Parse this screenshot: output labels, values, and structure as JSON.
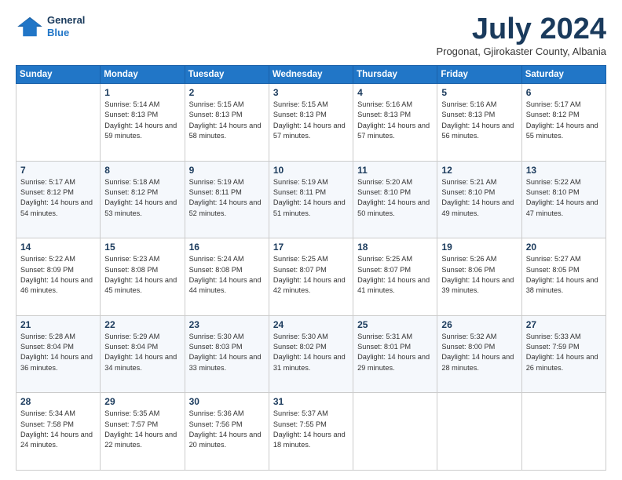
{
  "logo": {
    "line1": "General",
    "line2": "Blue"
  },
  "title": "July 2024",
  "location": "Progonat, Gjirokaster County, Albania",
  "days_header": [
    "Sunday",
    "Monday",
    "Tuesday",
    "Wednesday",
    "Thursday",
    "Friday",
    "Saturday"
  ],
  "weeks": [
    [
      {
        "day": "",
        "sunrise": "",
        "sunset": "",
        "daylight": ""
      },
      {
        "day": "1",
        "sunrise": "Sunrise: 5:14 AM",
        "sunset": "Sunset: 8:13 PM",
        "daylight": "Daylight: 14 hours and 59 minutes."
      },
      {
        "day": "2",
        "sunrise": "Sunrise: 5:15 AM",
        "sunset": "Sunset: 8:13 PM",
        "daylight": "Daylight: 14 hours and 58 minutes."
      },
      {
        "day": "3",
        "sunrise": "Sunrise: 5:15 AM",
        "sunset": "Sunset: 8:13 PM",
        "daylight": "Daylight: 14 hours and 57 minutes."
      },
      {
        "day": "4",
        "sunrise": "Sunrise: 5:16 AM",
        "sunset": "Sunset: 8:13 PM",
        "daylight": "Daylight: 14 hours and 57 minutes."
      },
      {
        "day": "5",
        "sunrise": "Sunrise: 5:16 AM",
        "sunset": "Sunset: 8:13 PM",
        "daylight": "Daylight: 14 hours and 56 minutes."
      },
      {
        "day": "6",
        "sunrise": "Sunrise: 5:17 AM",
        "sunset": "Sunset: 8:12 PM",
        "daylight": "Daylight: 14 hours and 55 minutes."
      }
    ],
    [
      {
        "day": "7",
        "sunrise": "Sunrise: 5:17 AM",
        "sunset": "Sunset: 8:12 PM",
        "daylight": "Daylight: 14 hours and 54 minutes."
      },
      {
        "day": "8",
        "sunrise": "Sunrise: 5:18 AM",
        "sunset": "Sunset: 8:12 PM",
        "daylight": "Daylight: 14 hours and 53 minutes."
      },
      {
        "day": "9",
        "sunrise": "Sunrise: 5:19 AM",
        "sunset": "Sunset: 8:11 PM",
        "daylight": "Daylight: 14 hours and 52 minutes."
      },
      {
        "day": "10",
        "sunrise": "Sunrise: 5:19 AM",
        "sunset": "Sunset: 8:11 PM",
        "daylight": "Daylight: 14 hours and 51 minutes."
      },
      {
        "day": "11",
        "sunrise": "Sunrise: 5:20 AM",
        "sunset": "Sunset: 8:10 PM",
        "daylight": "Daylight: 14 hours and 50 minutes."
      },
      {
        "day": "12",
        "sunrise": "Sunrise: 5:21 AM",
        "sunset": "Sunset: 8:10 PM",
        "daylight": "Daylight: 14 hours and 49 minutes."
      },
      {
        "day": "13",
        "sunrise": "Sunrise: 5:22 AM",
        "sunset": "Sunset: 8:10 PM",
        "daylight": "Daylight: 14 hours and 47 minutes."
      }
    ],
    [
      {
        "day": "14",
        "sunrise": "Sunrise: 5:22 AM",
        "sunset": "Sunset: 8:09 PM",
        "daylight": "Daylight: 14 hours and 46 minutes."
      },
      {
        "day": "15",
        "sunrise": "Sunrise: 5:23 AM",
        "sunset": "Sunset: 8:08 PM",
        "daylight": "Daylight: 14 hours and 45 minutes."
      },
      {
        "day": "16",
        "sunrise": "Sunrise: 5:24 AM",
        "sunset": "Sunset: 8:08 PM",
        "daylight": "Daylight: 14 hours and 44 minutes."
      },
      {
        "day": "17",
        "sunrise": "Sunrise: 5:25 AM",
        "sunset": "Sunset: 8:07 PM",
        "daylight": "Daylight: 14 hours and 42 minutes."
      },
      {
        "day": "18",
        "sunrise": "Sunrise: 5:25 AM",
        "sunset": "Sunset: 8:07 PM",
        "daylight": "Daylight: 14 hours and 41 minutes."
      },
      {
        "day": "19",
        "sunrise": "Sunrise: 5:26 AM",
        "sunset": "Sunset: 8:06 PM",
        "daylight": "Daylight: 14 hours and 39 minutes."
      },
      {
        "day": "20",
        "sunrise": "Sunrise: 5:27 AM",
        "sunset": "Sunset: 8:05 PM",
        "daylight": "Daylight: 14 hours and 38 minutes."
      }
    ],
    [
      {
        "day": "21",
        "sunrise": "Sunrise: 5:28 AM",
        "sunset": "Sunset: 8:04 PM",
        "daylight": "Daylight: 14 hours and 36 minutes."
      },
      {
        "day": "22",
        "sunrise": "Sunrise: 5:29 AM",
        "sunset": "Sunset: 8:04 PM",
        "daylight": "Daylight: 14 hours and 34 minutes."
      },
      {
        "day": "23",
        "sunrise": "Sunrise: 5:30 AM",
        "sunset": "Sunset: 8:03 PM",
        "daylight": "Daylight: 14 hours and 33 minutes."
      },
      {
        "day": "24",
        "sunrise": "Sunrise: 5:30 AM",
        "sunset": "Sunset: 8:02 PM",
        "daylight": "Daylight: 14 hours and 31 minutes."
      },
      {
        "day": "25",
        "sunrise": "Sunrise: 5:31 AM",
        "sunset": "Sunset: 8:01 PM",
        "daylight": "Daylight: 14 hours and 29 minutes."
      },
      {
        "day": "26",
        "sunrise": "Sunrise: 5:32 AM",
        "sunset": "Sunset: 8:00 PM",
        "daylight": "Daylight: 14 hours and 28 minutes."
      },
      {
        "day": "27",
        "sunrise": "Sunrise: 5:33 AM",
        "sunset": "Sunset: 7:59 PM",
        "daylight": "Daylight: 14 hours and 26 minutes."
      }
    ],
    [
      {
        "day": "28",
        "sunrise": "Sunrise: 5:34 AM",
        "sunset": "Sunset: 7:58 PM",
        "daylight": "Daylight: 14 hours and 24 minutes."
      },
      {
        "day": "29",
        "sunrise": "Sunrise: 5:35 AM",
        "sunset": "Sunset: 7:57 PM",
        "daylight": "Daylight: 14 hours and 22 minutes."
      },
      {
        "day": "30",
        "sunrise": "Sunrise: 5:36 AM",
        "sunset": "Sunset: 7:56 PM",
        "daylight": "Daylight: 14 hours and 20 minutes."
      },
      {
        "day": "31",
        "sunrise": "Sunrise: 5:37 AM",
        "sunset": "Sunset: 7:55 PM",
        "daylight": "Daylight: 14 hours and 18 minutes."
      },
      {
        "day": "",
        "sunrise": "",
        "sunset": "",
        "daylight": ""
      },
      {
        "day": "",
        "sunrise": "",
        "sunset": "",
        "daylight": ""
      },
      {
        "day": "",
        "sunrise": "",
        "sunset": "",
        "daylight": ""
      }
    ]
  ]
}
